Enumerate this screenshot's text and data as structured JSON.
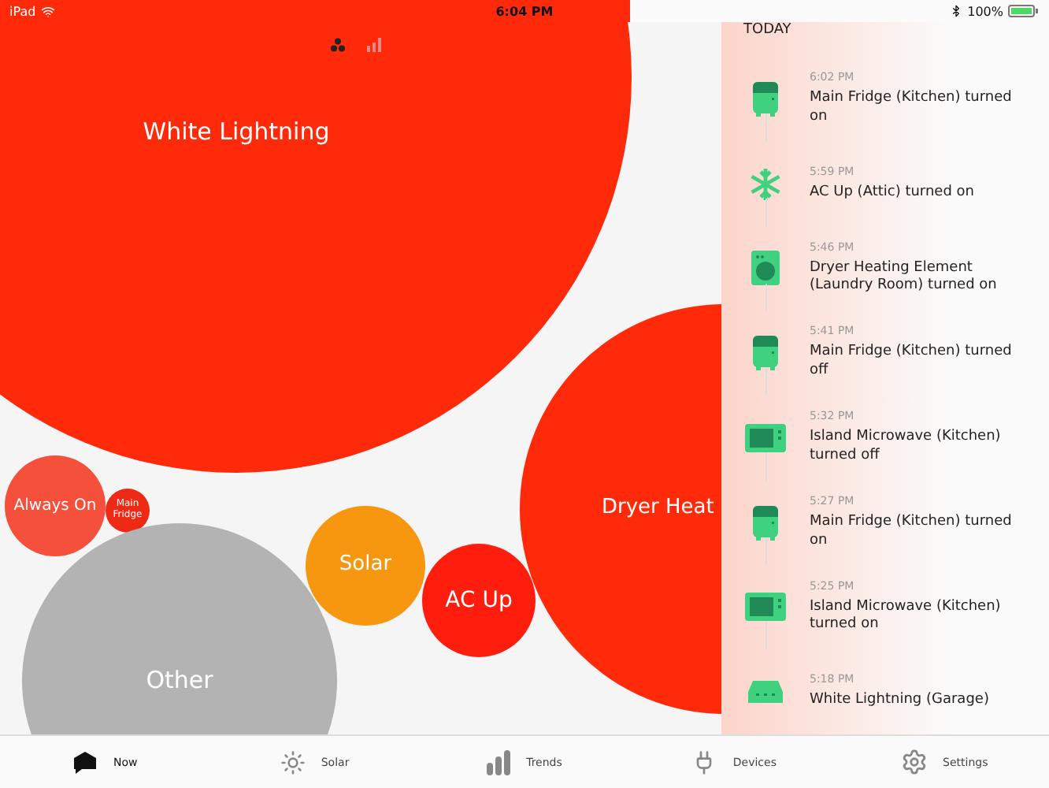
{
  "status_bar": {
    "device": "iPad",
    "time": "6:04 PM",
    "battery": "100%"
  },
  "view_toggle": [
    {
      "kind": "bubbles",
      "selected": true
    },
    {
      "kind": "bars",
      "selected": false
    }
  ],
  "bubbles": [
    {
      "label": "White Lightning",
      "color": "#ff2a0a"
    },
    {
      "label": "Always On",
      "color": "#f5503b"
    },
    {
      "label": "Main Fridge",
      "color": "#ee2a14"
    },
    {
      "label": "Dryer Heat",
      "color": "#ff2a0a"
    },
    {
      "label": "Solar",
      "color": "#f7960f"
    },
    {
      "label": "AC Up",
      "color": "#ff1e0e"
    },
    {
      "label": "Other",
      "color": "#b3b3b3"
    }
  ],
  "feed": {
    "heading": "TODAY",
    "events": [
      {
        "kind": "fridge",
        "time": "6:02 PM",
        "text": "Main Fridge (Kitchen) turned on"
      },
      {
        "kind": "snowflake",
        "time": "5:59 PM",
        "text": "AC Up (Attic) turned on"
      },
      {
        "kind": "washer",
        "time": "5:46 PM",
        "text": "Dryer Heating Element (Laundry Room) turned on"
      },
      {
        "kind": "fridge",
        "time": "5:41 PM",
        "text": "Main Fridge (Kitchen) turned off"
      },
      {
        "kind": "microwave",
        "time": "5:32 PM",
        "text": "Island Microwave (Kitchen) turned off"
      },
      {
        "kind": "fridge",
        "time": "5:27 PM",
        "text": "Main Fridge (Kitchen) turned on"
      },
      {
        "kind": "microwave",
        "time": "5:25 PM",
        "text": "Island Microwave (Kitchen) turned on"
      },
      {
        "kind": "car",
        "time": "5:18 PM",
        "text": "White Lightning (Garage)"
      }
    ]
  },
  "tab_bar": [
    {
      "kind": "now",
      "label": "Now",
      "selected": true
    },
    {
      "kind": "solar",
      "label": "Solar",
      "selected": false
    },
    {
      "kind": "trends",
      "label": "Trends",
      "selected": false
    },
    {
      "kind": "devices",
      "label": "Devices",
      "selected": false
    },
    {
      "kind": "settings",
      "label": "Settings",
      "selected": false
    }
  ]
}
